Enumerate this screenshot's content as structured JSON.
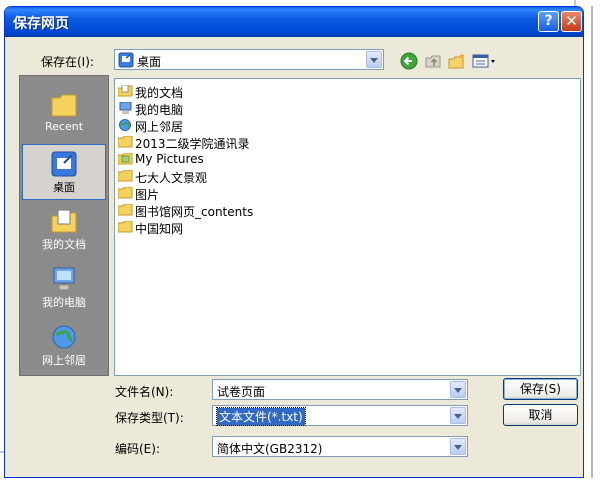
{
  "window": {
    "title": "保存网页",
    "help_label": "?",
    "close_label": "✕"
  },
  "location": {
    "label": "保存在(I):",
    "value": "桌面",
    "icon": "desktop-icon"
  },
  "toolbar": {
    "back_icon": "back-arrow-icon",
    "up_icon": "up-folder-icon",
    "new_folder_icon": "new-folder-icon",
    "view_icon": "view-menu-icon"
  },
  "places": [
    {
      "label": "Recent",
      "icon": "recent-folder-icon"
    },
    {
      "label": "桌面",
      "icon": "desktop-icon"
    },
    {
      "label": "我的文档",
      "icon": "my-documents-icon"
    },
    {
      "label": "我的电脑",
      "icon": "my-computer-icon"
    },
    {
      "label": "网上邻居",
      "icon": "network-places-icon"
    }
  ],
  "files": [
    {
      "label": "我的文档",
      "icon": "my-documents-icon"
    },
    {
      "label": "我的电脑",
      "icon": "my-computer-icon"
    },
    {
      "label": "网上邻居",
      "icon": "network-places-icon"
    },
    {
      "label": "2013二级学院通讯录",
      "icon": "folder-icon"
    },
    {
      "label": "My Pictures",
      "icon": "pictures-folder-icon"
    },
    {
      "label": "七大人文景观",
      "icon": "folder-icon"
    },
    {
      "label": "图片",
      "icon": "folder-icon"
    },
    {
      "label": "图书馆网页_contents",
      "icon": "folder-icon"
    },
    {
      "label": "中国知网",
      "icon": "folder-icon"
    }
  ],
  "filename": {
    "label": "文件名(N):",
    "value": "试卷页面"
  },
  "filetype": {
    "label": "保存类型(T):",
    "value": "文本文件(*.txt)"
  },
  "encoding": {
    "label": "编码(E):",
    "value": "简体中文(GB2312)"
  },
  "buttons": {
    "save": "保存(S)",
    "cancel": "取消"
  }
}
